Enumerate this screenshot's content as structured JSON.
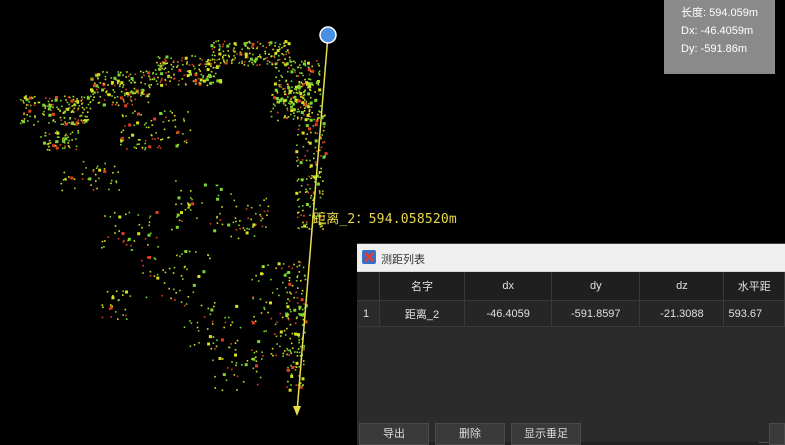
{
  "info": {
    "length": "长度: 594.059m",
    "dx": "Dx: -46.4059m",
    "dy": "Dy: -591.86m"
  },
  "measure_label": "距离_2：594.058520m",
  "panel": {
    "title": "测距列表",
    "columns": [
      "",
      "名字",
      "dx",
      "dy",
      "dz",
      "水平距"
    ],
    "rows": [
      [
        "1",
        "距离_2",
        "-46.4059",
        "-591.8597",
        "-21.3088",
        "593.67"
      ]
    ],
    "buttons": {
      "export": "导出",
      "delete": "删除",
      "show_perp": "显示垂足"
    }
  },
  "colors": {
    "line": "#e8e04a",
    "endpoint": "#4a90e2",
    "points_green": "#7cd632",
    "points_yellow": "#d8e020",
    "points_red": "#e04020"
  },
  "icons": [
    "app-close-x-icon",
    "measure-endpoint-icon"
  ]
}
